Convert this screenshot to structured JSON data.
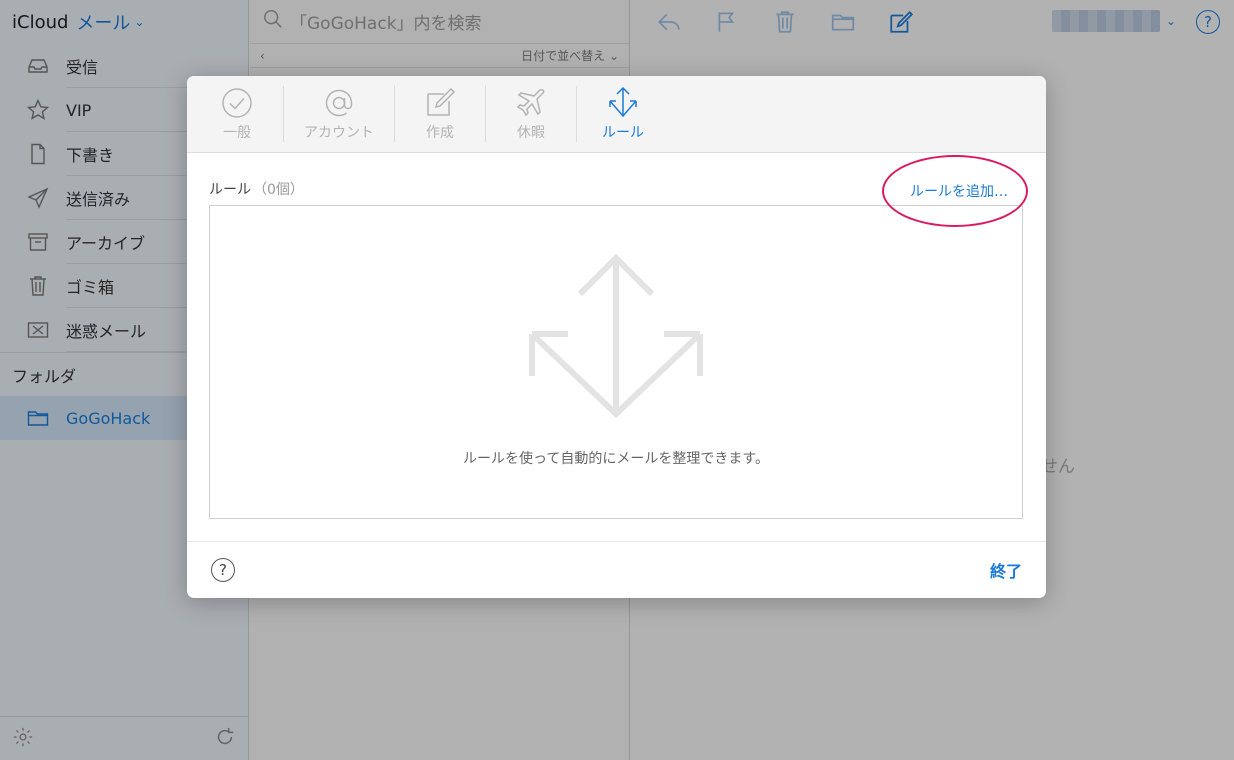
{
  "sidebar": {
    "brand": "iCloud",
    "app": "メール",
    "items": [
      {
        "label": "受信",
        "icon": "inbox-icon"
      },
      {
        "label": "VIP",
        "icon": "star-icon"
      },
      {
        "label": "下書き",
        "icon": "draft-icon"
      },
      {
        "label": "送信済み",
        "icon": "sent-icon"
      },
      {
        "label": "アーカイブ",
        "icon": "archive-icon"
      },
      {
        "label": "ゴミ箱",
        "icon": "trash-icon"
      },
      {
        "label": "迷惑メール",
        "icon": "junk-icon"
      }
    ],
    "folders_label": "フォルダ",
    "folder": {
      "label": "GoGoHack",
      "icon": "folder-icon"
    }
  },
  "list": {
    "search_placeholder": "「GoGoHack」内を検索",
    "sort_label": "日付で並べ替え"
  },
  "reader": {
    "no_message_fragment": "せん",
    "help_glyph": "?"
  },
  "modal": {
    "tabs": [
      {
        "label": "一般",
        "icon": "checkmark-circle-icon",
        "active": false
      },
      {
        "label": "アカウント",
        "icon": "at-sign-icon",
        "active": false
      },
      {
        "label": "作成",
        "icon": "compose-icon",
        "active": false
      },
      {
        "label": "休暇",
        "icon": "airplane-icon",
        "active": false
      },
      {
        "label": "ルール",
        "icon": "rules-arrows-icon",
        "active": true
      }
    ],
    "rules_title": "ルール",
    "rules_count": "（0個）",
    "add_rule": "ルールを追加…",
    "empty_text": "ルールを使って自動的にメールを整理できます。",
    "help_glyph": "?",
    "done": "終了"
  },
  "colors": {
    "accent": "#1a7ad8",
    "highlight": "#d81b60",
    "sidebar_bg": "#eaf1f7",
    "selected_folder_bg": "#cfe1f3"
  }
}
